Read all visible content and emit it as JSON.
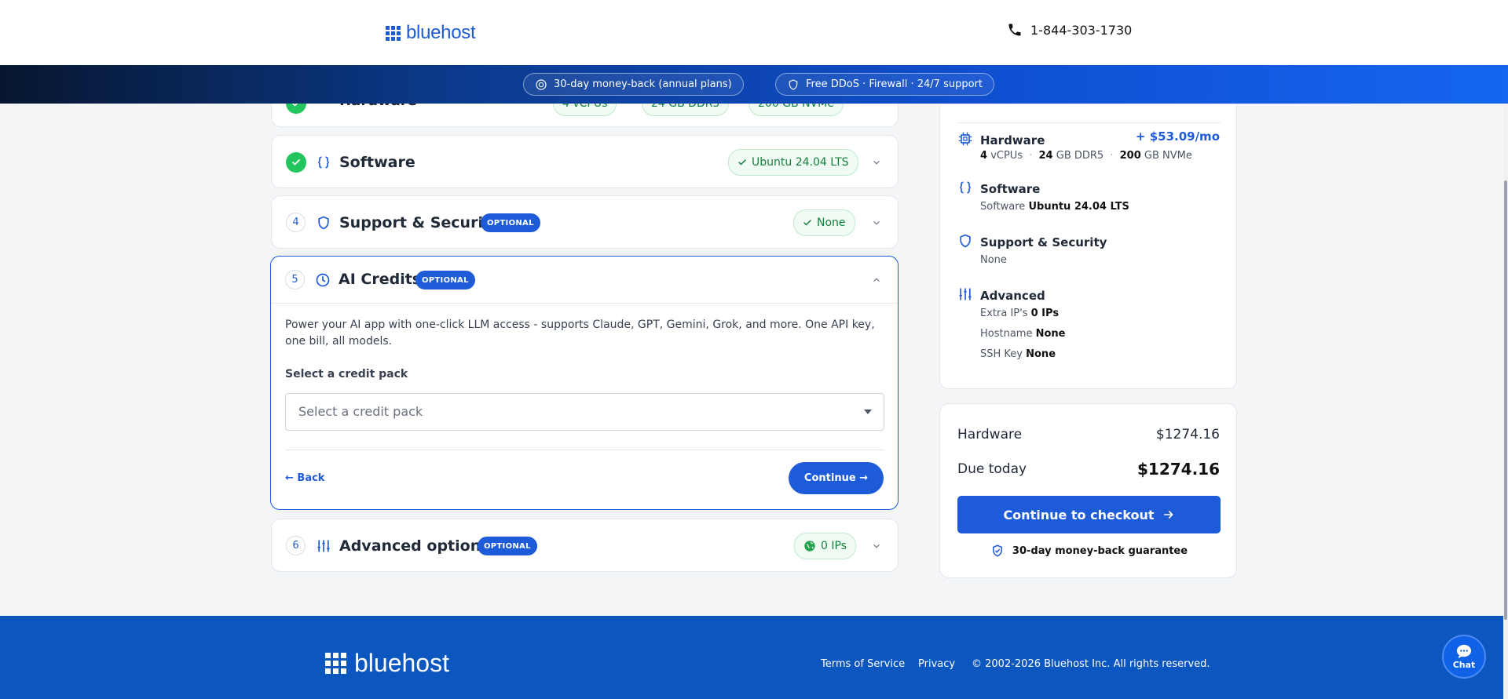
{
  "header": {
    "logo_text": "bluehost",
    "phone": "1-844-303-1730"
  },
  "banner": {
    "money_back": "30-day money-back (annual plans)",
    "security": "Free DDoS · Firewall · 24/7 support"
  },
  "steps": {
    "hardware": {
      "title": "Hardware",
      "chips": [
        "4 vCPUs",
        "24 GB DDR5",
        "200 GB NVMe"
      ]
    },
    "software": {
      "title": "Software",
      "chip": "Ubuntu 24.04 LTS"
    },
    "support": {
      "number": "4",
      "title": "Support & Security",
      "badge": "OPTIONAL",
      "chip": "None"
    },
    "ai_credits": {
      "number": "5",
      "title": "AI Credits",
      "badge": "OPTIONAL",
      "description": "Power your AI app with one-click LLM access - supports Claude, GPT, Gemini, Grok, and more. One API key, one bill, all models.",
      "select_label": "Select a credit pack",
      "select_placeholder": "Select a credit pack",
      "back_label": "← Back",
      "continue_label": "Continue →"
    },
    "advanced": {
      "number": "6",
      "title": "Advanced options",
      "badge": "OPTIONAL",
      "chip": "0 IPs"
    }
  },
  "summary": {
    "hardware": {
      "label": "Hardware",
      "price": "+ $53.09/mo",
      "vcpu_num": "4",
      "vcpu_unit": "vCPUs",
      "ram_num": "24",
      "ram_unit": "GB DDR5",
      "disk_num": "200",
      "disk_unit": "GB NVMe",
      "sep": "·"
    },
    "software": {
      "label": "Software",
      "key": "Software",
      "value": "Ubuntu 24.04 LTS"
    },
    "support": {
      "label": "Support & Security",
      "value": "None"
    },
    "advanced": {
      "label": "Advanced",
      "extra_ips_key": "Extra IP's",
      "extra_ips_value": "0 IPs",
      "hostname_key": "Hostname",
      "hostname_value": "None",
      "ssh_key": "SSH Key",
      "ssh_value": "None"
    }
  },
  "totals": {
    "hardware_label": "Hardware",
    "hardware_value": "$1274.16",
    "due_label": "Due today",
    "due_value": "$1274.16",
    "checkout_label": "Continue to checkout",
    "guarantee": "30-day money-back guarantee"
  },
  "footer": {
    "logo_text": "bluehost",
    "terms": "Terms of Service",
    "privacy": "Privacy",
    "copyright": "© 2002-2026 Bluehost Inc. All rights reserved."
  },
  "chat": {
    "label": "Chat"
  },
  "colors": {
    "brand_blue": "#1d5bd8",
    "success_green": "#22c55e",
    "footer_blue": "#0b56bf"
  }
}
